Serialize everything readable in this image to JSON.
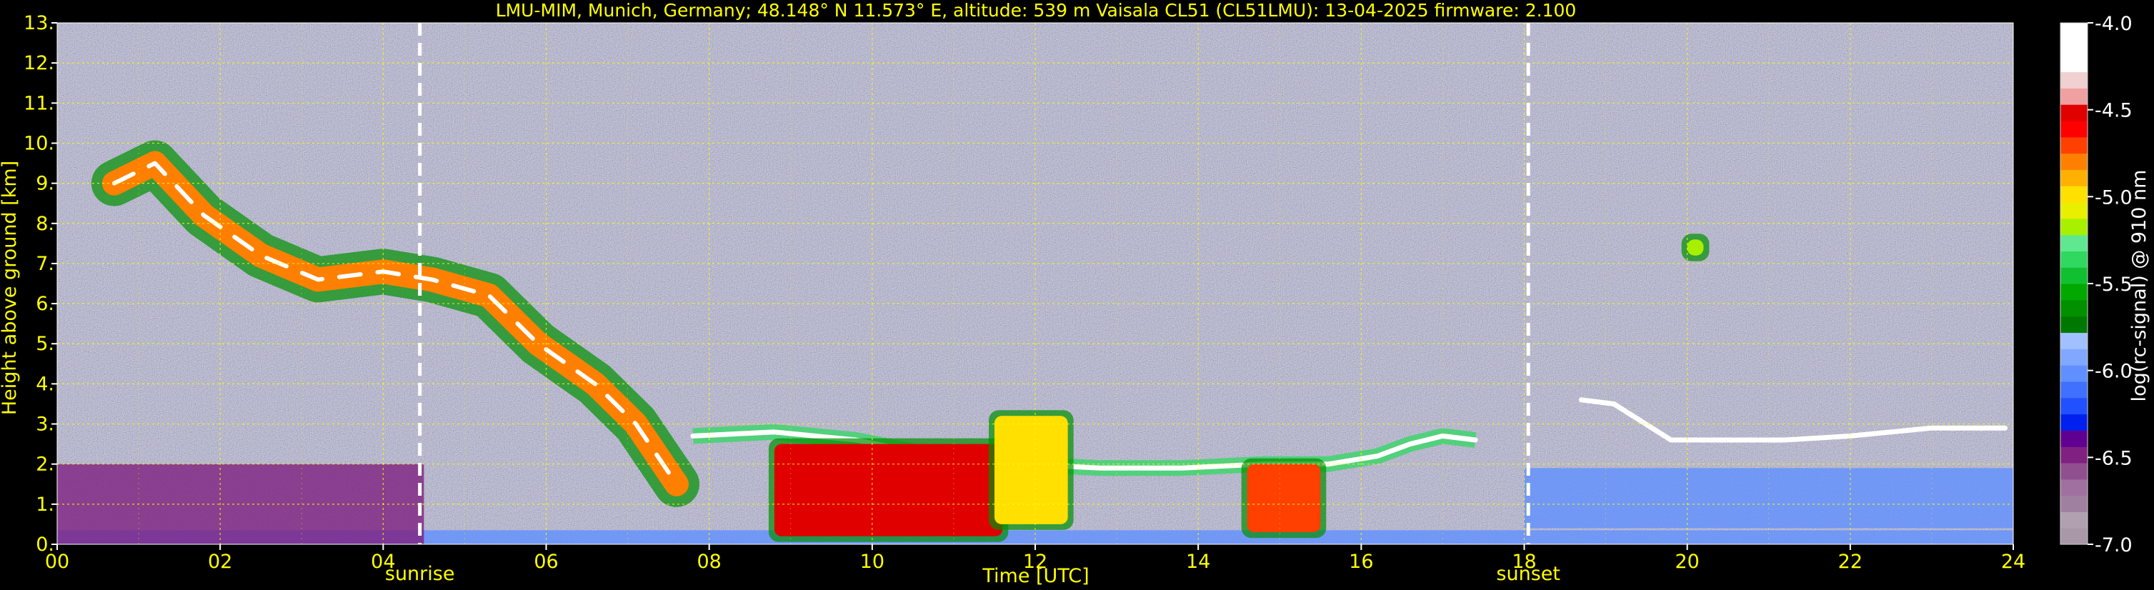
{
  "chart_data": {
    "type": "heatmap",
    "title": "LMU-MIM, Munich, Germany; 48.148° N 11.573° E, altitude: 539 m    Vaisala CL51 (CL51LMU): 13-04-2025    firmware: 2.100",
    "xlabel": "Time [UTC]",
    "ylabel": "Height above ground [km]",
    "xlim": [
      0,
      24
    ],
    "ylim": [
      0,
      13
    ],
    "x_ticks": [
      {
        "value": 0,
        "label": "00"
      },
      {
        "value": 2,
        "label": "02"
      },
      {
        "value": 4,
        "label": "04"
      },
      {
        "value": 6,
        "label": "06"
      },
      {
        "value": 8,
        "label": "08"
      },
      {
        "value": 10,
        "label": "10"
      },
      {
        "value": 12,
        "label": "12"
      },
      {
        "value": 14,
        "label": "14"
      },
      {
        "value": 16,
        "label": "16"
      },
      {
        "value": 18,
        "label": "18"
      },
      {
        "value": 20,
        "label": "20"
      },
      {
        "value": 22,
        "label": "22"
      },
      {
        "value": 24,
        "label": "24"
      }
    ],
    "y_ticks": [
      {
        "value": 0,
        "label": "0."
      },
      {
        "value": 1,
        "label": "1."
      },
      {
        "value": 2,
        "label": "2."
      },
      {
        "value": 3,
        "label": "3."
      },
      {
        "value": 4,
        "label": "4."
      },
      {
        "value": 5,
        "label": "5."
      },
      {
        "value": 6,
        "label": "6."
      },
      {
        "value": 7,
        "label": "7."
      },
      {
        "value": 8,
        "label": "8."
      },
      {
        "value": 9,
        "label": "9."
      },
      {
        "value": 10,
        "label": "10."
      },
      {
        "value": 11,
        "label": "11."
      },
      {
        "value": 12,
        "label": "12."
      },
      {
        "value": 13,
        "label": "13."
      }
    ],
    "grid": true,
    "events": [
      {
        "label": "sunrise",
        "time": 4.45
      },
      {
        "label": "sunset",
        "time": 18.05
      }
    ],
    "colorbar": {
      "label": "log(rc-signal) @ 910 nm",
      "range": [
        -7.0,
        -4.0
      ],
      "ticks": [
        {
          "value": -4.0,
          "label": "-4.0"
        },
        {
          "value": -4.5,
          "label": "-4.5"
        },
        {
          "value": -5.0,
          "label": "-5.0"
        },
        {
          "value": -5.5,
          "label": "-5.5"
        },
        {
          "value": -6.0,
          "label": "-6.0"
        },
        {
          "value": -6.5,
          "label": "-6.5"
        },
        {
          "value": -7.0,
          "label": "-7.0"
        }
      ],
      "colors": [
        "#a898a8",
        "#b0a0b0",
        "#a080a0",
        "#a070a0",
        "#905090",
        "#802080",
        "#600090",
        "#0020f0",
        "#2050ff",
        "#4070ff",
        "#6090ff",
        "#80a8ff",
        "#a0c0ff",
        "#007800",
        "#009000",
        "#00a800",
        "#10c030",
        "#30d860",
        "#60e890",
        "#a8f000",
        "#e8f000",
        "#ffe000",
        "#ffb000",
        "#ff8000",
        "#ff4000",
        "#ff0000",
        "#e00000",
        "#f0a0a0",
        "#f0d0d0",
        "#ffffff",
        "#ffffff",
        "#ffffff"
      ]
    },
    "features": [
      {
        "kind": "aerosol_layer",
        "t0": 0.0,
        "t1": 24.0,
        "top": 0.35,
        "level": -6.0
      },
      {
        "kind": "residual_layer",
        "t0": 0.0,
        "t1": 4.5,
        "top": 2.0,
        "level": -6.5
      },
      {
        "kind": "cirrus_band",
        "path": [
          [
            0.7,
            9.0
          ],
          [
            1.2,
            9.5
          ],
          [
            1.8,
            8.2
          ],
          [
            2.5,
            7.2
          ],
          [
            3.2,
            6.6
          ],
          [
            4.0,
            6.8
          ],
          [
            4.6,
            6.6
          ],
          [
            5.3,
            6.2
          ],
          [
            5.9,
            5.0
          ],
          [
            6.6,
            4.0
          ],
          [
            7.1,
            3.0
          ],
          [
            7.6,
            1.5
          ]
        ],
        "level": -4.8
      },
      {
        "kind": "cloud_top_line",
        "path": [
          [
            7.8,
            2.7
          ],
          [
            8.8,
            2.8
          ],
          [
            9.8,
            2.6
          ],
          [
            10.8,
            2.2
          ],
          [
            11.8,
            2.0
          ],
          [
            12.8,
            1.9
          ],
          [
            13.8,
            1.9
          ],
          [
            14.8,
            2.0
          ],
          [
            15.6,
            2.0
          ],
          [
            16.2,
            2.2
          ],
          [
            16.6,
            2.5
          ],
          [
            17.0,
            2.7
          ],
          [
            17.4,
            2.6
          ]
        ],
        "level": -4.0
      },
      {
        "kind": "lower_cloud",
        "t0": 8.8,
        "t1": 11.6,
        "base": 0.2,
        "top": 2.5,
        "level": -4.5
      },
      {
        "kind": "lower_cloud",
        "t0": 14.6,
        "t1": 15.5,
        "base": 0.3,
        "top": 2.0,
        "level": -4.7
      },
      {
        "kind": "lower_cloud",
        "t0": 11.5,
        "t1": 12.4,
        "base": 0.5,
        "top": 3.2,
        "level": -5.0
      },
      {
        "kind": "boundary_layer",
        "t0": 18.0,
        "t1": 24.0,
        "base": 0.4,
        "top": 1.9,
        "level": -6.0
      },
      {
        "kind": "scattered_cloud_tops",
        "path": [
          [
            18.7,
            3.6
          ],
          [
            19.1,
            3.5
          ],
          [
            19.8,
            2.6
          ],
          [
            20.4,
            2.6
          ],
          [
            21.2,
            2.6
          ],
          [
            22.0,
            2.7
          ],
          [
            23.0,
            2.9
          ],
          [
            23.9,
            2.9
          ]
        ],
        "level": -4.0
      },
      {
        "kind": "small_cloud",
        "t: ": 0,
        "t0": 20.0,
        "t1": 20.2,
        "base": 7.2,
        "top": 7.6,
        "level": -5.2
      }
    ]
  }
}
